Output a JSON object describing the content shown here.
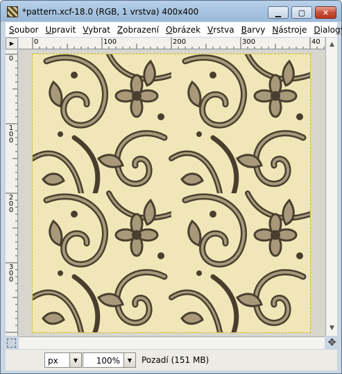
{
  "window": {
    "title": "*pattern.xcf-18.0 (RGB, 1 vrstva) 400x400",
    "minimize_symbol": "▁",
    "maximize_symbol": "▢",
    "close_symbol": "✕"
  },
  "menu": [
    {
      "accel": "S",
      "rest": "oubor"
    },
    {
      "accel": "U",
      "rest": "pravit"
    },
    {
      "accel": "V",
      "rest": "ybrat"
    },
    {
      "accel": "Z",
      "rest": "obrazení"
    },
    {
      "accel": "O",
      "rest": "brázek"
    },
    {
      "accel": "V",
      "rest": "rstva"
    },
    {
      "accel": "B",
      "rest": "arvy"
    },
    {
      "accel": "N",
      "rest": "ástroje"
    },
    {
      "accel": "D",
      "rest": "ialogy"
    }
  ],
  "rulers": {
    "horizontal": [
      "0",
      "100",
      "200",
      "300",
      "40"
    ],
    "vertical": [
      [
        "0"
      ],
      [
        "1",
        "0",
        "0"
      ],
      [
        "2",
        "0",
        "0"
      ],
      [
        "3",
        "0",
        "0"
      ]
    ]
  },
  "statusbar": {
    "unit": "px",
    "zoom": "100%",
    "layer_info": "Pozadí (151 MB)"
  },
  "icons": {
    "menu_arrow": "menu-arrow-icon",
    "navigate": "navigate-icon",
    "quick_mask": "quick-mask-icon",
    "dropdown": "chevron-down-icon"
  },
  "colors": {
    "pattern_light": "#f0e6b8",
    "pattern_dark": "#4a3f2e",
    "pattern_mid": "#a8997a",
    "selection_outline": "#d3c200"
  }
}
